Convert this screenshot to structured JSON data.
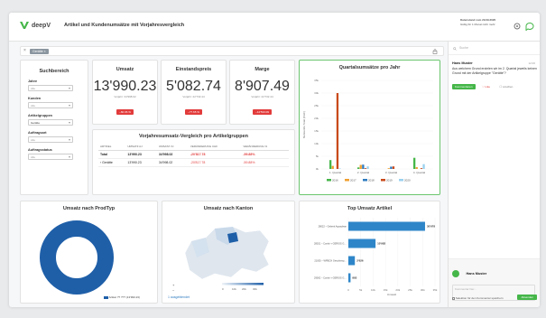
{
  "header": {
    "logo_text": "deepV",
    "title": "Artikel und Kundenumsätze mit Vorjahresvergleich",
    "info_line1": "Datenstand vom 29.09.2020",
    "info_line2": "Gültig für 1 Monat nicht mehr"
  },
  "filterbar": {
    "chip": "Gerätte ×"
  },
  "filters": {
    "title": "Suchbereich",
    "fields": [
      {
        "label": "Jahre",
        "value": "Alle"
      },
      {
        "label": "Kunden",
        "value": "Alle"
      },
      {
        "label": "Artikelgruppen",
        "value": "Gerätte"
      },
      {
        "label": "Auftragsart",
        "value": "Alle"
      },
      {
        "label": "Auftragsstatus",
        "value": "Alle"
      }
    ]
  },
  "kpis": [
    {
      "title": "Umsatz",
      "value": "13'990.23",
      "sub": "Vorjahr: 34'998.02",
      "badge": "−60.06 %"
    },
    {
      "title": "Einstandspreis",
      "value": "5'082.74",
      "sub": "Vorjahr: 22'732.44",
      "badge": "−77.65 %"
    },
    {
      "title": "Marge",
      "value": "8'907.49",
      "sub": "Vorjahr: 22'732.44",
      "badge": "−12'533.09"
    }
  ],
  "table": {
    "title": "Vorjahresumsatz-Vergleich pro Artikelgruppen",
    "headers": [
      "ARTIKEL",
      "UMSATZ AJ",
      "UMSATZ VJ",
      "VERÄNDERUNG CHF",
      "VERÄNDERUNG %"
    ],
    "rows": [
      [
        "Total",
        "13'990.23",
        "34'998.02",
        "-20'817.78",
        "-59.88%"
      ],
      [
        "› Gerätte",
        "13'990.23",
        "34'998.02",
        "-20'817.78",
        "-59.88%"
      ]
    ]
  },
  "quarterly": {
    "title": "Quartalsumsätze pro Jahr"
  },
  "prodtyp": {
    "title": "Umsatz nach ProdTyp",
    "legend": "Artikel ?? ??? (13'990.23)"
  },
  "kanton": {
    "title": "Umsatz nach Kanton",
    "link": "1 ausgeblendet"
  },
  "topartikel": {
    "title": "Top Umsatz Artikel"
  },
  "chart_data": [
    {
      "type": "bar",
      "title": "Quartalsumsätze pro Jahr",
      "categories": [
        "1. Quartal",
        "2. Quartal",
        "3. Quartal",
        "4. Quartal"
      ],
      "series": [
        {
          "name": "2016",
          "color": "#45b649",
          "values": [
            3500,
            600,
            0,
            4400
          ]
        },
        {
          "name": "2017",
          "color": "#f0a030",
          "values": [
            1200,
            1600,
            300,
            700
          ]
        },
        {
          "name": "2018",
          "color": "#2e7bbf",
          "values": [
            0,
            1700,
            900,
            0
          ]
        },
        {
          "name": "2019",
          "color": "#c94a1c",
          "values": [
            30000,
            300,
            1000,
            300
          ]
        },
        {
          "name": "2020",
          "color": "#9ad1ef",
          "values": [
            200,
            1000,
            0,
            1900
          ]
        }
      ],
      "ylabel": "Nettoerlös Total (CHF)",
      "yticks": [
        "0k",
        "5k",
        "10k",
        "15k",
        "20k",
        "25k",
        "30k",
        "35k"
      ],
      "ylim": [
        0,
        35000
      ]
    },
    {
      "type": "bar",
      "title": "Top Umsatz Artikel",
      "categories": [
        "28022 – Geberit Aquaclean",
        "28021 – Combi + GERIOS GP12956",
        "21005 – WPBOX Geschirrspuler",
        "29002 – Combi + GERIOS GP12952"
      ],
      "values": [
        30978,
        10982,
        2626,
        882
      ],
      "value_labels": [
        "30'978",
        "10'982",
        "2'626",
        "882"
      ],
      "xticks": [
        "0",
        "5k",
        "10k",
        "15k",
        "20k",
        "25k",
        "30k",
        "35k"
      ],
      "xlabel": "Umsatz",
      "xlim": [
        0,
        35000
      ]
    }
  ],
  "rightpanel": {
    "search_placeholder": "Suche",
    "comment_author": "Hans Muster",
    "comment_time": "12:00",
    "comment_text": "Aus welchem Grund erzielen wir im 2. Quartal jeweils keinen Grund mit der Artikelgruppe \"Gerätte\"?",
    "btn_comment": "Kommentieren",
    "btn_like": "Like",
    "btn_delete": "Löschen",
    "compose_author": "Hans Muster",
    "compose_placeholder": "Kommentar hier...",
    "checkbox_label": "Selektion für den Kommentar speichern",
    "send_label": "Absenden"
  }
}
